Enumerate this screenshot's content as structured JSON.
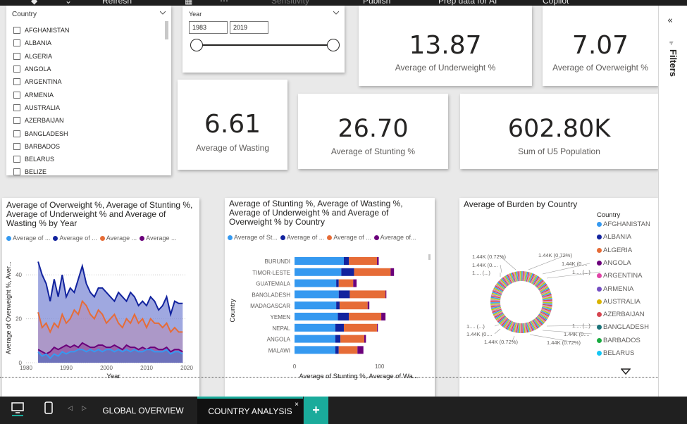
{
  "ribbon": {
    "refresh": "Refresh",
    "sensitivity": "Sensitivity",
    "publish": "Publish",
    "prep_data": "Prep data for AI",
    "copilot": "Copilot"
  },
  "country_slicer": {
    "title": "Country",
    "items": [
      "AFGHANISTAN",
      "ALBANIA",
      "ALGERIA",
      "ANGOLA",
      "ARGENTINA",
      "ARMENIA",
      "AUSTRALIA",
      "AZERBAIJAN",
      "BANGLADESH",
      "BARBADOS",
      "BELARUS",
      "BELIZE"
    ]
  },
  "year_slicer": {
    "title": "Year",
    "from": "1983",
    "to": "2019"
  },
  "kpis": {
    "underweight": {
      "value": "13.87",
      "label": "Average of Underweight %"
    },
    "overweight": {
      "value": "7.07",
      "label": "Average of Overweight %"
    },
    "wasting": {
      "value": "6.61",
      "label": "Average of Wasting"
    },
    "stunting": {
      "value": "26.70",
      "label": "Average of Stunting %"
    },
    "population": {
      "value": "602.80K",
      "label": "Sum of U5 Population"
    }
  },
  "colors": {
    "overweight": "#3599f0",
    "underweight": "#12239e",
    "stunting": "#e66c37",
    "wasting": "#6b007b"
  },
  "chart_data": [
    {
      "type": "area",
      "title": "Average of Overweight %, Average of Stunting %, Average of Underweight % and Average of Wasting % by Year",
      "legend": [
        "Average of ...",
        "Average of ...",
        "Average ...",
        "Average ..."
      ],
      "xlabel": "Year",
      "ylabel": "Average of Overweight %, Aver...",
      "x_ticks": [
        "1980",
        "1990",
        "2000",
        "2010",
        "2020"
      ],
      "y_ticks": [
        "0",
        "20",
        "40"
      ],
      "xlim": [
        1980,
        2020
      ],
      "ylim": [
        0,
        50
      ],
      "x": [
        1983,
        1984,
        1985,
        1986,
        1987,
        1988,
        1989,
        1990,
        1991,
        1992,
        1993,
        1994,
        1995,
        1996,
        1997,
        1998,
        1999,
        2000,
        2001,
        2002,
        2003,
        2004,
        2005,
        2006,
        2007,
        2008,
        2009,
        2010,
        2011,
        2012,
        2013,
        2014,
        2015,
        2016,
        2017,
        2018,
        2019
      ],
      "series": [
        {
          "name": "Average of Underweight %",
          "values": [
            46,
            40,
            36,
            28,
            38,
            30,
            40,
            30,
            34,
            32,
            38,
            44,
            36,
            32,
            30,
            34,
            34,
            32,
            30,
            28,
            32,
            30,
            28,
            32,
            30,
            26,
            28,
            26,
            30,
            28,
            24,
            26,
            30,
            22,
            28,
            27,
            27
          ]
        },
        {
          "name": "Average of Stunting %",
          "values": [
            23,
            16,
            18,
            14,
            18,
            16,
            22,
            18,
            20,
            24,
            22,
            28,
            26,
            22,
            20,
            24,
            22,
            18,
            20,
            22,
            18,
            16,
            20,
            18,
            22,
            18,
            20,
            16,
            20,
            18,
            18,
            16,
            18,
            14,
            16,
            14,
            14
          ]
        },
        {
          "name": "Average of Wasting %",
          "values": [
            6,
            5,
            4,
            5,
            7,
            6,
            7,
            8,
            7,
            8,
            7,
            9,
            8,
            7,
            7,
            8,
            8,
            7,
            7,
            8,
            7,
            6,
            8,
            7,
            7,
            6,
            7,
            6,
            7,
            7,
            6,
            6,
            7,
            5,
            6,
            6,
            5
          ]
        },
        {
          "name": "Average of Overweight %",
          "values": [
            5,
            3,
            4,
            2,
            4,
            3,
            5,
            4,
            5,
            5,
            6,
            6,
            5,
            6,
            5,
            6,
            5,
            6,
            6,
            5,
            6,
            5,
            6,
            5,
            6,
            5,
            5,
            6,
            6,
            5,
            5,
            5,
            6,
            4,
            5,
            5,
            4
          ]
        }
      ]
    },
    {
      "type": "bar",
      "title": "Average of Stunting %, Average of Wasting %, Average of Underweight % and Average of Overweight % by Country",
      "legend": [
        "Average of St...",
        "Average of ...",
        "Average of ...",
        "Average of..."
      ],
      "ylabel": "Country",
      "xlabel": "Average of Stunting %, Average of Wa...",
      "x_ticks": [
        "0",
        "100"
      ],
      "xlim": [
        0,
        150
      ],
      "categories": [
        "BURUNDI",
        "TIMOR-LESTE",
        "GUATEMALA",
        "BANGLADESH",
        "MADAGASCAR",
        "YEMEN",
        "NEPAL",
        "ANGOLA",
        "MALAWI"
      ],
      "series": [
        {
          "name": "Average of Stunting %",
          "values": [
            58,
            55,
            49,
            52,
            49,
            51,
            48,
            48,
            48
          ]
        },
        {
          "name": "Average of Wasting %",
          "values": [
            6,
            15,
            3,
            13,
            4,
            13,
            10,
            6,
            4
          ]
        },
        {
          "name": "Average of Underweight %",
          "values": [
            33,
            43,
            17,
            42,
            33,
            38,
            39,
            28,
            22
          ]
        },
        {
          "name": "Average of Overweight %",
          "values": [
            2,
            4,
            4,
            1,
            2,
            5,
            1,
            2,
            7
          ]
        }
      ]
    },
    {
      "type": "pie",
      "title": "Average of Burden by Country",
      "legend_title": "Country",
      "legend": [
        "AFGHANISTAN",
        "ALBANIA",
        "ALGERIA",
        "ANGOLA",
        "ARGENTINA",
        "ARMENIA",
        "AUSTRALIA",
        "AZERBAIJAN",
        "BANGLADESH",
        "BARBADOS",
        "BELARUS"
      ],
      "legend_colors": [
        "#3599f0",
        "#12239e",
        "#e66c37",
        "#6b007b",
        "#e044a7",
        "#744ec2",
        "#d9b300",
        "#d64550",
        "#197278",
        "#1aab40",
        "#15c6f4"
      ],
      "slice_count": 140,
      "slice_value": "1.44K",
      "data_labels": [
        "1.44K (0.72%)",
        "1.44K (0....",
        "1.... (...)",
        "1.44K (0.72%)",
        "1.44K (0....",
        "1.... (...)",
        "1.... (...)",
        "1.44K (0....",
        "1.44K (0.72%)",
        "1.44K (0.72%)",
        "1.44K (0....",
        "1.... (...)"
      ]
    }
  ],
  "filters": {
    "label": "Filters"
  },
  "tabs": [
    "GLOBAL OVERVIEW",
    "COUNTRY ANALYSIS"
  ]
}
